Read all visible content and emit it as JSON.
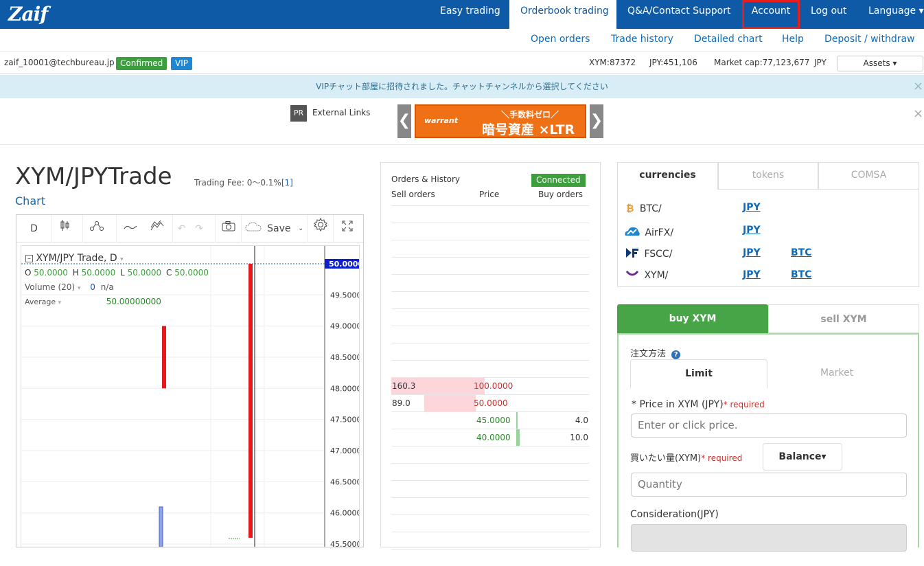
{
  "nav": {
    "logo": "Zaif",
    "items": [
      {
        "label": "Easy trading",
        "active": false
      },
      {
        "label": "Orderbook trading",
        "active": true
      },
      {
        "label": "Q&A/Contact Support",
        "active": false
      },
      {
        "label": "Account",
        "active": false,
        "highlighted": true
      },
      {
        "label": "Log out",
        "active": false
      },
      {
        "label": "Language ▾",
        "active": false
      }
    ]
  },
  "subnav": {
    "items": [
      "Open orders",
      "Trade history",
      "Detailed chart",
      "Help",
      "Deposit / withdraw"
    ]
  },
  "user": {
    "email": "zaif_10001@techbureau.jp",
    "status_badge": "Confirmed",
    "vip_badge": "VIP",
    "xym_balance": "XYM:87372",
    "jpy_balance": "JPY:451,106",
    "market_cap": "Market cap:77,123,677",
    "market_cap_unit": "JPY",
    "assets_button": "Assets ▾"
  },
  "notice": {
    "text": "VIPチャット部屋に招待されました。チャットチャンネルから選択してください",
    "close": "×"
  },
  "links": {
    "pr": "PR",
    "label": "External Links",
    "banner_brand": "warrant",
    "banner_line1": "＼手数料ゼロ／",
    "banner_line2": "暗号資産 ×LTR",
    "prev": "❮",
    "next": "❯",
    "close": "×"
  },
  "trade": {
    "title": "XYM/JPYTrade",
    "fee_label": "Trading Fee: 0～0.1%",
    "fee_note": "[1]",
    "chart_link": "Chart"
  },
  "chart_toolbar": {
    "interval": "D",
    "save": "Save"
  },
  "chart_data": {
    "type": "candlestick",
    "title": "XYM/JPY Trade, D",
    "ohlc_label": {
      "o": "O",
      "h": "H",
      "l": "L",
      "c": "C",
      "o_val": "50.0000",
      "h_val": "50.0000",
      "l_val": "50.0000",
      "c_val": "50.0000"
    },
    "volume_label": "Volume (20)",
    "volume_value": "0",
    "volume_na": "n/a",
    "average_label": "Average",
    "average_value": "50.00000000",
    "last_price_label": "50.0000",
    "yticks": [
      "49.5000",
      "49.0000",
      "48.5000",
      "48.0000",
      "47.5000",
      "47.0000",
      "46.5000",
      "46.0000",
      "45.5000"
    ],
    "ylim": [
      45.5,
      50.0
    ],
    "candles": [
      {
        "open": 49.0,
        "close": 48.0,
        "high": 49.0,
        "low": 48.0
      },
      {
        "open": 50.0,
        "close": 45.6,
        "high": 50.0,
        "low": 45.5
      }
    ]
  },
  "orderbook": {
    "title": "Orders & History",
    "connected": "Connected",
    "col_sell": "Sell orders",
    "col_price": "Price",
    "col_buy": "Buy orders",
    "rows": [
      {
        "sell": "160.3",
        "price": "100.0000",
        "buy": "",
        "side": "sell",
        "depth": 1.0
      },
      {
        "sell": "89.0",
        "price": "50.0000",
        "buy": "",
        "side": "sell",
        "depth": 0.55
      },
      {
        "sell": "",
        "price": "45.0000",
        "buy": "4.0",
        "side": "buy",
        "depth": 0.4
      },
      {
        "sell": "",
        "price": "40.0000",
        "buy": "10.0",
        "side": "buy",
        "depth": 1.0
      }
    ]
  },
  "currencies": {
    "tabs": [
      "currencies",
      "tokens",
      "COMSA"
    ],
    "items": [
      {
        "name": "BTC/",
        "icon": "bitcoin-icon",
        "links": [
          "JPY"
        ]
      },
      {
        "name": "AirFX/",
        "icon": "airfx-icon",
        "links": [
          "JPY"
        ]
      },
      {
        "name": "FSCC/",
        "icon": "fscc-icon",
        "links": [
          "JPY",
          "BTC"
        ]
      },
      {
        "name": "XYM/",
        "icon": "xym-icon",
        "links": [
          "JPY",
          "BTC"
        ]
      }
    ]
  },
  "order_form": {
    "buy_tab": "buy XYM",
    "sell_tab": "sell XYM",
    "method_label": "注文方法",
    "limit": "Limit",
    "market": "Market",
    "price_label": "* Price in XYM (JPY)",
    "required": "* required",
    "price_placeholder": "Enter or click price.",
    "qty_label": "買いたい量(XYM)",
    "balance_btn": "Balance▾",
    "qty_placeholder": "Quantity",
    "consideration_label": "Consideration(JPY)"
  }
}
